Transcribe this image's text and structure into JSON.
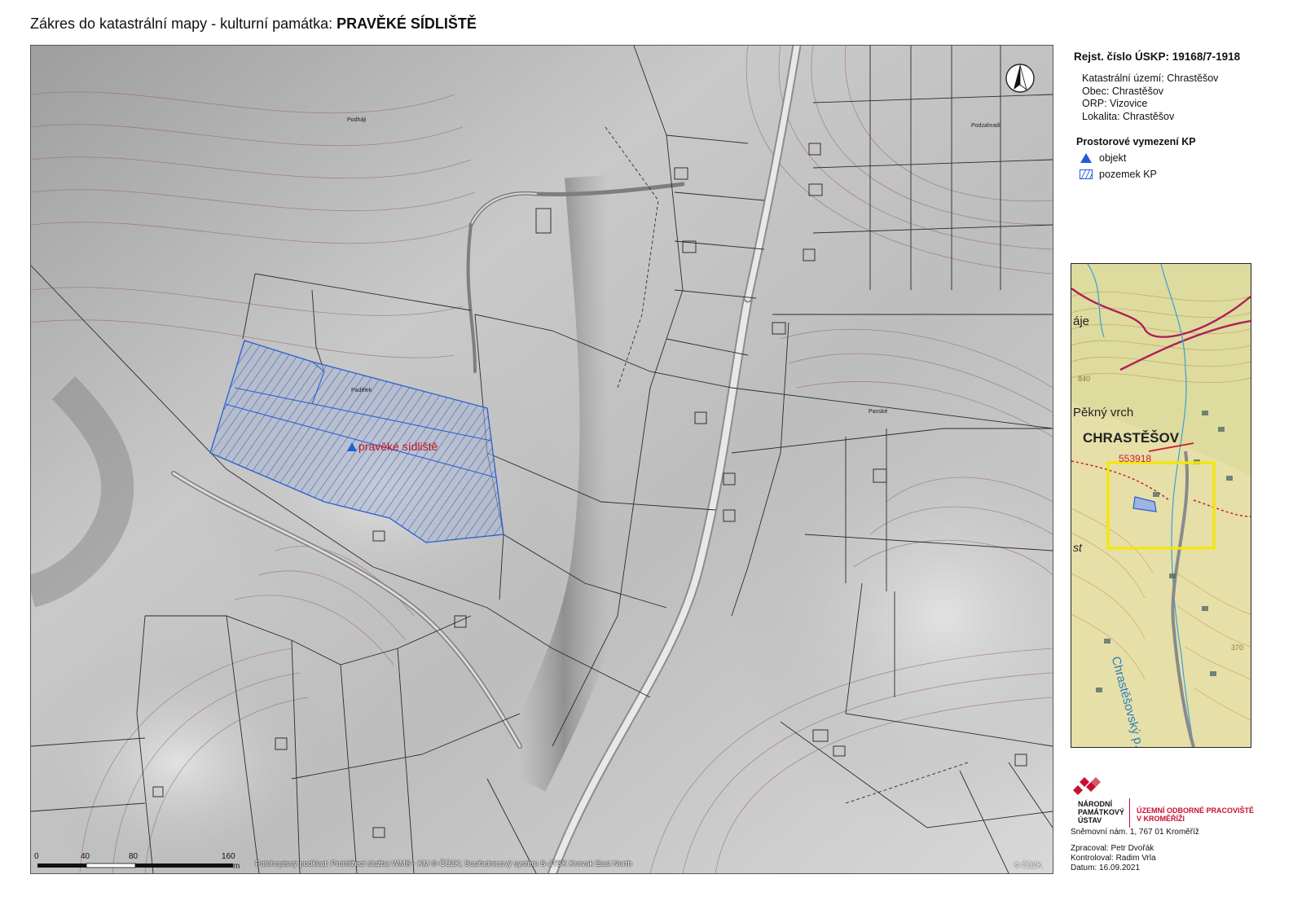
{
  "title": {
    "prefix": "Zákres do katastrální mapy - kulturní památka:",
    "name": "PRAVĚKÉ SÍDLIŠTĚ"
  },
  "info": {
    "registration": "Rejst. číslo ÚSKP: 19168/7-1918",
    "cadastral": "Katastrální území: Chrastěšov",
    "municipality": "Obec: Chrastěšov",
    "orp": "ORP:  Vizovice",
    "locality": "Lokalita: Chrastěšov"
  },
  "legend": {
    "title": "Prostorové vymezení KP",
    "items": [
      {
        "label": "objekt",
        "symbol": "blue-triangle-icon"
      },
      {
        "label": "pozemek KP",
        "symbol": "hatched-area-icon"
      }
    ],
    "color": "#1f5fd6"
  },
  "map": {
    "place_labels": [
      "Podháji",
      "Podzahradí",
      "Padělek",
      "Panské"
    ],
    "object_label": "pravěké sídliště",
    "object_color": "#c0121b",
    "scale_labels": [
      "0",
      "40",
      "80",
      "160",
      "m"
    ],
    "source": "Polohopisný podklad: Prohlížecí služba WMS - KM © ČÚZK;  Souřadnicový systém S-JTSK Krovak East North",
    "copyright": "© ČÚZK"
  },
  "inset": {
    "labels": [
      "áje",
      "840",
      "Pěkný vrch",
      "CHRASTĚŠOV",
      "553918",
      "st",
      "Chrastěšovský p.",
      "370"
    ],
    "frame_color": "#f5e800"
  },
  "organization": {
    "name_lines": [
      "NÁRODNÍ",
      "PAMÁTKOVÝ",
      "ÚSTAV"
    ],
    "unit_lines": [
      "ÚZEMNÍ ODBORNÉ PRACOVIŠTĚ",
      "V KROMĚŘÍŽI"
    ],
    "address": "Sněmovní nám. 1, 767 01 Kroměříž",
    "brand_color": "#c8102e"
  },
  "credits": {
    "processed_by": "Zpracoval: Petr Dvořák",
    "checked_by": "Kontroloval: Radim Vrla",
    "date": "Datum: 16.09.2021"
  }
}
